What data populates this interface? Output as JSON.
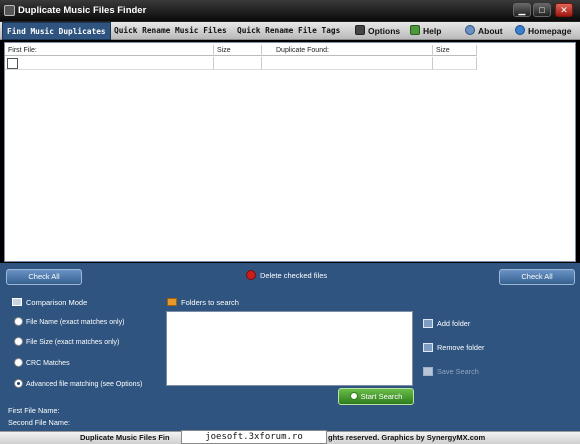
{
  "window": {
    "title": "Duplicate Music Files Finder",
    "controls": {
      "minimize": "▁",
      "maximize": "□",
      "close": "✕"
    }
  },
  "menu": {
    "tabs": [
      {
        "label": "Find Music Duplicates",
        "active": true
      },
      {
        "label": "Quick Rename Music Files",
        "active": false
      },
      {
        "label": "Quick Rename File Tags",
        "active": false
      }
    ],
    "items": [
      {
        "label": "Options",
        "icon": "options-icon"
      },
      {
        "label": "Help",
        "icon": "help-book-icon"
      },
      {
        "label": "About",
        "icon": "about-gear-icon"
      },
      {
        "label": "Homepage",
        "icon": "globe-icon"
      }
    ]
  },
  "results_table": {
    "columns": [
      "First File:",
      "Size",
      "Duplicate Found:",
      "Size"
    ]
  },
  "actions": {
    "check_all_left": "Check All",
    "delete_checked": "Delete checked files",
    "check_all_right": "Check All"
  },
  "comparison": {
    "title": "Comparison Mode",
    "options": [
      {
        "label": "File Name (exact matches only)",
        "selected": false
      },
      {
        "label": "File Size (exact matches only)",
        "selected": false
      },
      {
        "label": "CRC Matches",
        "selected": false
      },
      {
        "label": "Advanced file matching (see Options)",
        "selected": true
      }
    ]
  },
  "folders": {
    "title": "Folders to search",
    "add": "Add folder",
    "remove": "Remove folder",
    "save": "Save Search",
    "start": "Start Search"
  },
  "file_info": {
    "first_label": "First File Name:",
    "second_label": "Second File Name:"
  },
  "status": {
    "left_text": "Duplicate Music Files Fin",
    "right_text": "ghts reserved. Graphics by SynergyMX.com",
    "overlay_text": "joesoft.3xforum.ro"
  },
  "colors": {
    "panel_blue": "#2f547f",
    "button_blue": "#4f7fb6",
    "start_green": "#3f9a2a",
    "delete_red": "#c81e1e"
  }
}
